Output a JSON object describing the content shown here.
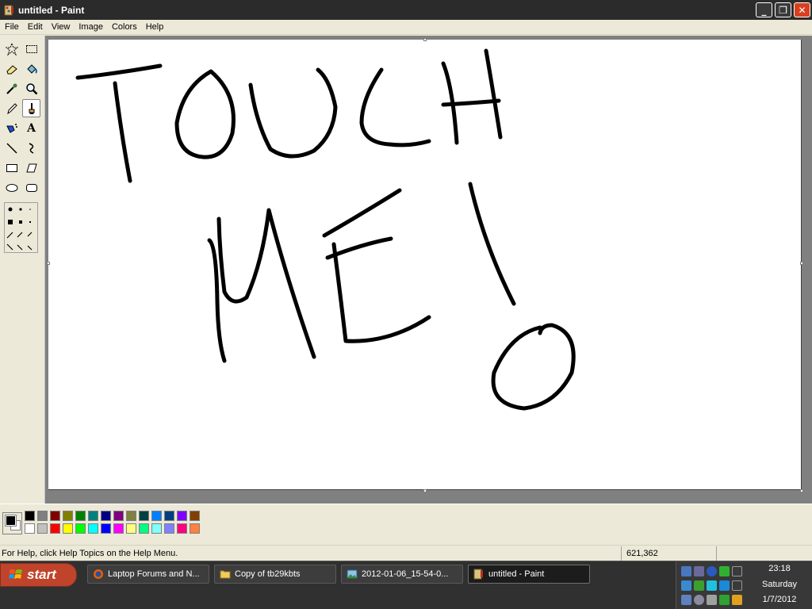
{
  "window": {
    "title": "untitled - Paint",
    "minimize_label": "_",
    "restore_label": "❐",
    "close_label": "✕"
  },
  "menu": [
    "File",
    "Edit",
    "View",
    "Image",
    "Colors",
    "Help"
  ],
  "tools": [
    {
      "name": "free-form-select",
      "icon": "star-select-icon"
    },
    {
      "name": "select",
      "icon": "rect-select-icon"
    },
    {
      "name": "eraser",
      "icon": "eraser-icon"
    },
    {
      "name": "fill-with-color",
      "icon": "paint-bucket-icon"
    },
    {
      "name": "pick-color",
      "icon": "eyedropper-icon"
    },
    {
      "name": "magnifier",
      "icon": "magnifier-icon"
    },
    {
      "name": "pencil",
      "icon": "pencil-icon"
    },
    {
      "name": "brush",
      "icon": "brush-icon",
      "selected": true
    },
    {
      "name": "airbrush",
      "icon": "airbrush-icon"
    },
    {
      "name": "text",
      "icon": "text-icon",
      "glyph": "A"
    },
    {
      "name": "line",
      "icon": "line-icon"
    },
    {
      "name": "curve",
      "icon": "curve-icon"
    },
    {
      "name": "rectangle",
      "icon": "rectangle-icon"
    },
    {
      "name": "polygon",
      "icon": "polygon-icon"
    },
    {
      "name": "ellipse",
      "icon": "ellipse-icon"
    },
    {
      "name": "rounded-rectangle",
      "icon": "rounded-rectangle-icon"
    }
  ],
  "palette": {
    "foreground": "#000000",
    "background": "#ffffff",
    "row1": [
      "#000000",
      "#808080",
      "#800000",
      "#808000",
      "#008000",
      "#008080",
      "#000080",
      "#800080",
      "#808040",
      "#004040",
      "#0080ff",
      "#004080",
      "#8000ff",
      "#804000"
    ],
    "row2": [
      "#ffffff",
      "#c0c0c0",
      "#ff0000",
      "#ffff00",
      "#00ff00",
      "#00ffff",
      "#0000ff",
      "#ff00ff",
      "#ffff80",
      "#00ff80",
      "#80ffff",
      "#8080ff",
      "#ff0080",
      "#ff8040"
    ]
  },
  "canvas": {
    "drawing": "TOUCH ME!"
  },
  "status": {
    "help": "For Help, click Help Topics on the Help Menu.",
    "coords": "621,362"
  },
  "taskbar": {
    "start_label": "start",
    "tasks": [
      {
        "label": "Laptop Forums and N...",
        "icon": "firefox-icon"
      },
      {
        "label": "Copy of tb29kbts",
        "icon": "folder-icon"
      },
      {
        "label": "2012-01-06_15-54-0...",
        "icon": "image-viewer-icon"
      },
      {
        "label": "untitled - Paint",
        "icon": "paint-icon",
        "active": true
      }
    ],
    "clock": {
      "time": "23:18",
      "day": "Saturday",
      "date": "1/7/2012"
    }
  }
}
